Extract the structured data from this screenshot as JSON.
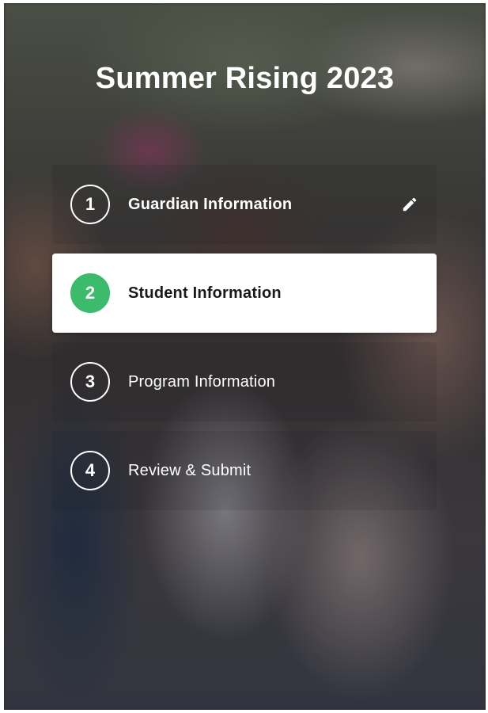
{
  "page": {
    "title": "Summer Rising 2023"
  },
  "steps": [
    {
      "number": "1",
      "label": "Guardian Information",
      "state": "completed",
      "action_icon": "pencil-icon"
    },
    {
      "number": "2",
      "label": "Student Information",
      "state": "active"
    },
    {
      "number": "3",
      "label": "Program Information",
      "state": "upcoming"
    },
    {
      "number": "4",
      "label": "Review & Submit",
      "state": "upcoming"
    }
  ],
  "colors": {
    "active_step_circle": "#3dbb6c",
    "active_step_background": "#ffffff",
    "overlay_text": "#ffffff",
    "active_step_text": "#1a1a1a"
  }
}
